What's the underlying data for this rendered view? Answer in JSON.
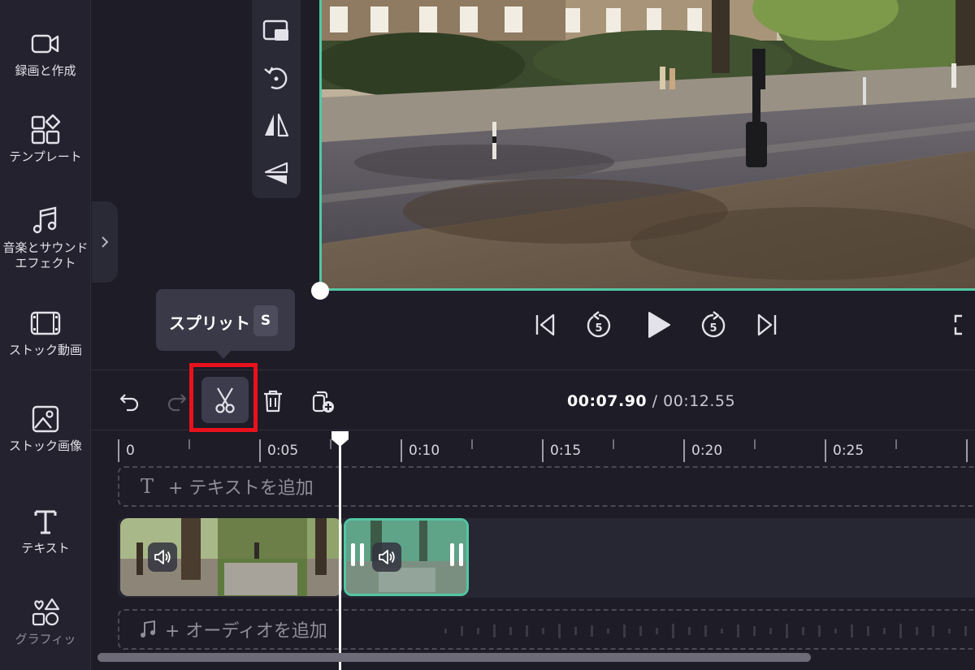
{
  "sidebar": {
    "items": [
      {
        "label": "録画と作成",
        "icon": "video-camera-icon"
      },
      {
        "label": "テンプレート",
        "icon": "templates-icon"
      },
      {
        "label": "音楽とサウンドエフェクト",
        "icon": "music-note-icon"
      },
      {
        "label": "ストック動画",
        "icon": "film-icon"
      },
      {
        "label": "ストック画像",
        "icon": "image-icon"
      },
      {
        "label": "テキスト",
        "icon": "text-icon"
      },
      {
        "label": "グラフィッ",
        "icon": "graphics-icon"
      }
    ]
  },
  "preview_tools": [
    "picture-in-picture-icon",
    "rotate-icon",
    "flip-horizontal-icon",
    "flip-vertical-icon"
  ],
  "player_controls": [
    "skip-to-start-icon",
    "rewind-5-icon",
    "play-icon",
    "forward-5-icon",
    "skip-to-end-icon",
    "fullscreen-icon"
  ],
  "player": {
    "rewind_seconds": "5",
    "forward_seconds": "5"
  },
  "tooltip": {
    "label": "スプリット",
    "shortcut": "S"
  },
  "timeline": {
    "current_time": "00:07.90",
    "separator": " / ",
    "total_time": "00:12.55",
    "ruler_labels": [
      "0",
      "0:05",
      "0:10",
      "0:15",
      "0:20",
      "0:25"
    ],
    "add_text_label": "+ テキストを追加",
    "add_audio_label": "+ オーディオを追加",
    "text_track_icon": "T"
  },
  "colors": {
    "accent": "#52c7a4",
    "highlight_box": "#e8121c",
    "background": "#1d1c27"
  }
}
